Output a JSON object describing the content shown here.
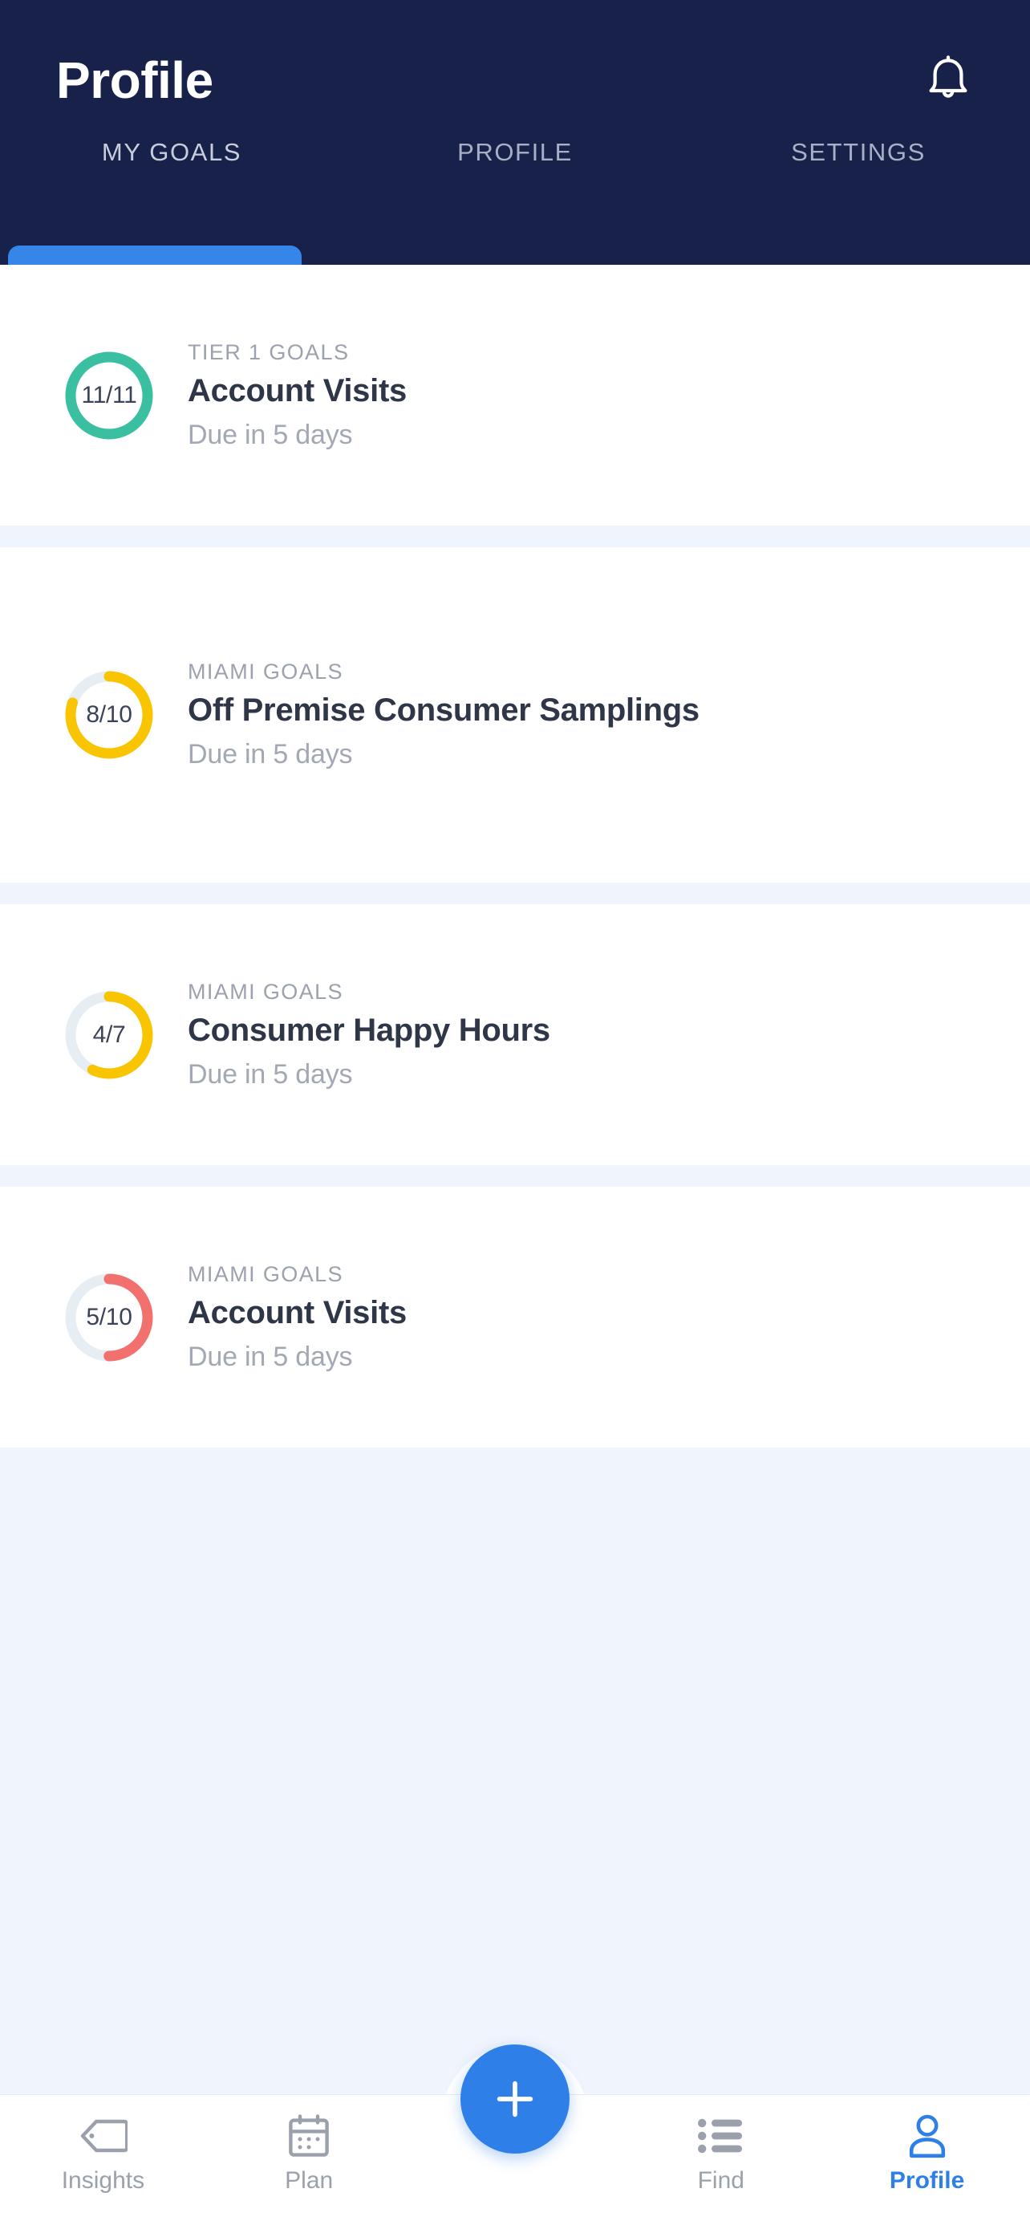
{
  "header": {
    "title": "Profile",
    "notification_icon": "bell-icon",
    "tabs": [
      {
        "label": "MY GOALS",
        "active": true
      },
      {
        "label": "PROFILE",
        "active": false
      },
      {
        "label": "SETTINGS",
        "active": false
      }
    ],
    "background_color": "#18214A",
    "indicator_color": "#3586E8"
  },
  "goals": [
    {
      "category": "TIER 1 GOALS",
      "title": "Account Visits",
      "due": "Due in 5 days",
      "progress_label": "11/11",
      "current": 11,
      "target": 11,
      "percent": 100,
      "ring_color": "#3BBFA1"
    },
    {
      "category": "MIAMI GOALS",
      "title": "Off Premise Consumer Samplings",
      "due": "Due in 5 days",
      "progress_label": "8/10",
      "current": 8,
      "target": 10,
      "percent": 80,
      "ring_color": "#F9C400"
    },
    {
      "category": "MIAMI GOALS",
      "title": "Consumer Happy Hours",
      "due": "Due in 5 days",
      "progress_label": "4/7",
      "current": 4,
      "target": 7,
      "percent": 57,
      "ring_color": "#F9C400"
    },
    {
      "category": "MIAMI GOALS",
      "title": "Account Visits",
      "due": "Due in 5 days",
      "progress_label": "5/10",
      "current": 5,
      "target": 10,
      "percent": 50,
      "ring_color": "#F2706E"
    }
  ],
  "ring_track_color": "#E6EDF3",
  "bottom_nav": {
    "items": [
      {
        "label": "Insights",
        "icon": "tag-icon",
        "active": false
      },
      {
        "label": "Plan",
        "icon": "calendar-icon",
        "active": false
      },
      {
        "label": "Find",
        "icon": "list-icon",
        "active": false
      },
      {
        "label": "Profile",
        "icon": "person-icon",
        "active": true
      }
    ],
    "fab": {
      "icon": "plus-icon",
      "color": "#2E7FE8"
    },
    "active_color": "#2E7FE8",
    "inactive_color": "#9AA0AC"
  }
}
